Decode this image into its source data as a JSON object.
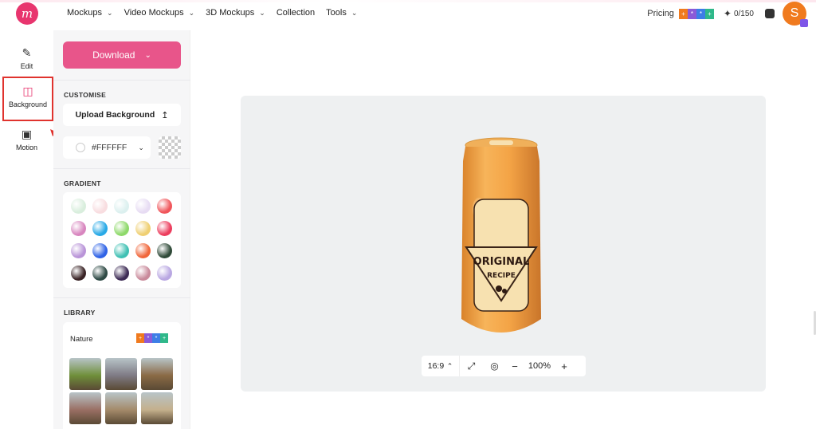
{
  "header": {
    "logo_text": "m",
    "nav": [
      {
        "label": "Mockups"
      },
      {
        "label": "Video Mockups"
      },
      {
        "label": "3D Mockups"
      },
      {
        "label": "Collection"
      },
      {
        "label": "Tools"
      }
    ],
    "pricing_label": "Pricing",
    "credits": "0/150",
    "avatar_initial": "S"
  },
  "rail": {
    "items": [
      {
        "label": "Edit",
        "icon": "pencil-icon"
      },
      {
        "label": "Background",
        "icon": "background-icon",
        "active": true
      },
      {
        "label": "Motion",
        "icon": "motion-icon"
      }
    ]
  },
  "panel": {
    "download_label": "Download",
    "customise_title": "CUSTOMISE",
    "upload_background_label": "Upload Background",
    "color_value": "#FFFFFF",
    "gradient_title": "GRADIENT",
    "gradients": [
      "#d9eedd",
      "#f8dde0",
      "#dcf0ef",
      "#e7dcf3",
      "#f0555a",
      "#d886bf",
      "#28a9e6",
      "#8ed96a",
      "#efcf72",
      "#ec3d5d",
      "#b994d8",
      "#2f63e6",
      "#3fc0b3",
      "#f0663a",
      "#2f4a38",
      "#3a2426",
      "#2e4a45",
      "#3d2b55",
      "#c98a9b",
      "#b9a7e2"
    ],
    "library_title": "LIBRARY",
    "library_name": "Nature",
    "thumbs": [
      "#6f8f3a",
      "#7e7a84",
      "#8a6a45",
      "#9a6f64",
      "#a48a6a",
      "#c4b08c"
    ]
  },
  "canvas": {
    "background": "#eef0f1",
    "product_text_line1": "ORIGINAL",
    "product_text_line2": "RECIPE",
    "aspect_ratio": "16:9",
    "zoom": "100%"
  },
  "colors": {
    "accent": "#e8558a",
    "highlight_box": "#e0332e",
    "can_orange": "#f2a541"
  }
}
